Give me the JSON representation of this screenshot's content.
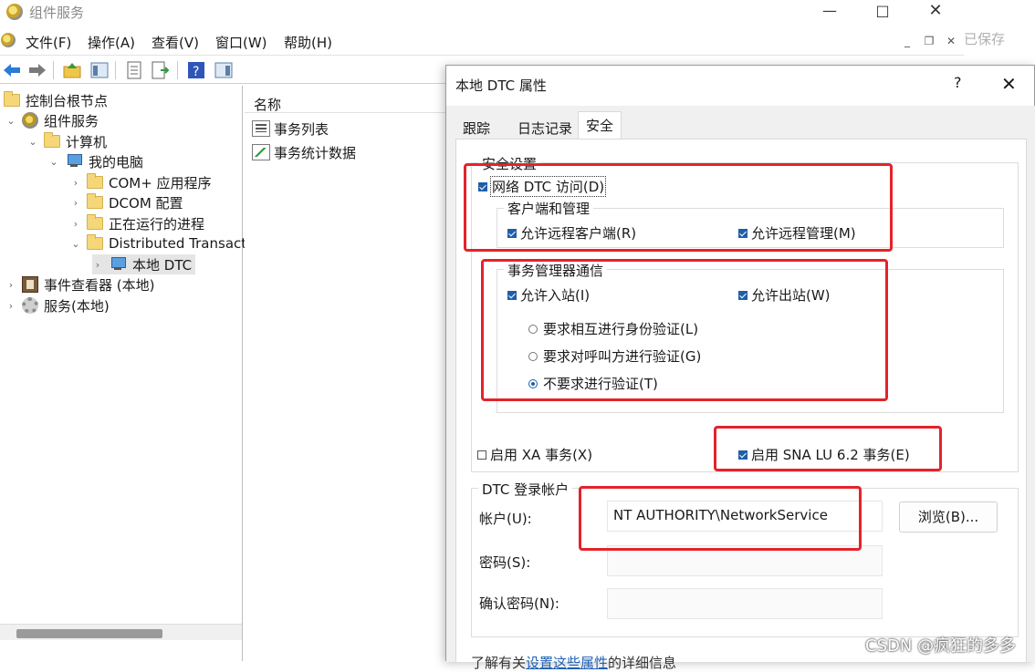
{
  "main_window": {
    "title": "组件服务",
    "saved_text": "已保存",
    "menu": [
      "文件(F)",
      "操作(A)",
      "查看(V)",
      "窗口(W)",
      "帮助(H)"
    ],
    "tree": [
      {
        "label": "控制台根节点",
        "icon": "folder-icon"
      },
      {
        "label": "组件服务",
        "icon": "component-services-icon"
      },
      {
        "label": "计算机",
        "icon": "folder-icon"
      },
      {
        "label": "我的电脑",
        "icon": "computer-icon"
      },
      {
        "label": "COM+ 应用程序",
        "icon": "folder-icon"
      },
      {
        "label": "DCOM 配置",
        "icon": "folder-icon"
      },
      {
        "label": "正在运行的进程",
        "icon": "folder-icon"
      },
      {
        "label": "Distributed Transacti",
        "icon": "folder-icon"
      },
      {
        "label": "本地 DTC",
        "icon": "computer-icon"
      },
      {
        "label": "事件查看器 (本地)",
        "icon": "event-viewer-icon"
      },
      {
        "label": "服务(本地)",
        "icon": "services-icon"
      }
    ],
    "list": {
      "header": "名称",
      "items": [
        "事务列表",
        "事务统计数据"
      ]
    }
  },
  "dialog": {
    "title": "本地 DTC 属性",
    "help": "?",
    "tabs": [
      "跟踪",
      "日志记录",
      "安全"
    ],
    "active_tab": "安全",
    "security_settings": {
      "label": "安全设置",
      "network_dtc_access": "网络 DTC 访问(D)",
      "client_admin": {
        "label": "客户端和管理",
        "allow_remote_clients": "允许远程客户端(R)",
        "allow_remote_admin": "允许远程管理(M)"
      },
      "tm_comm": {
        "label": "事务管理器通信",
        "allow_inbound": "允许入站(I)",
        "allow_outbound": "允许出站(W)",
        "auth_mutual": "要求相互进行身份验证(L)",
        "auth_incoming": "要求对呼叫方进行验证(G)",
        "auth_none": "不要求进行验证(T)"
      },
      "enable_xa": "启用 XA 事务(X)",
      "enable_sna": "启用 SNA LU 6.2 事务(E)"
    },
    "logon": {
      "label": "DTC 登录帐户",
      "account_label": "帐户(U):",
      "account_value": "NT AUTHORITY\\NetworkService",
      "browse": "浏览(B)...",
      "password_label": "密码(S):",
      "confirm_label": "确认密码(N):"
    },
    "footnote_prefix": "了解有关",
    "footnote_link": "设置这些属性",
    "footnote_suffix": "的详细信息"
  },
  "watermark": "CSDN @疯狂的多多",
  "colors": {
    "accent": "#1f5fa8",
    "highlight": "#e3232b"
  }
}
